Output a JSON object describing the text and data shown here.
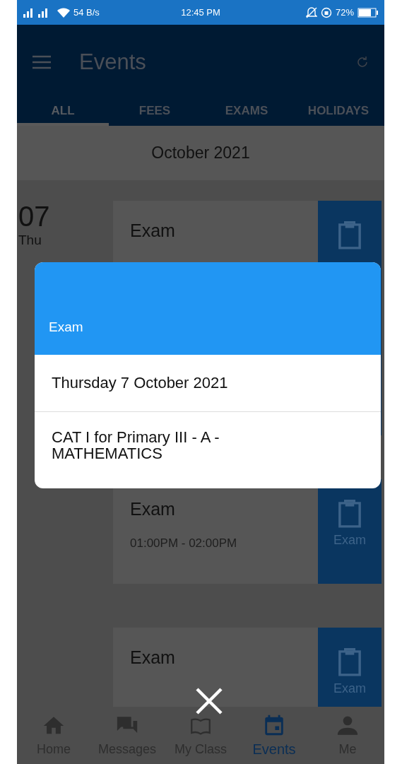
{
  "status_bar": {
    "network": "54 B/s",
    "time": "12:45 PM",
    "battery": "72%"
  },
  "app_bar": {
    "title": "Events"
  },
  "tabs": [
    {
      "label": "ALL",
      "selected": true
    },
    {
      "label": "FEES",
      "selected": false
    },
    {
      "label": "EXAMS",
      "selected": false
    },
    {
      "label": "HOLIDAYS",
      "selected": false
    }
  ],
  "month": "October 2021",
  "events": [
    {
      "day": "07",
      "weekday": "Thu",
      "title": "Exam"
    },
    {
      "title": "Exam",
      "time": "01:00PM - 02:00PM",
      "tag": "Exam"
    },
    {
      "title": "Exam",
      "tag": "Exam"
    }
  ],
  "dialog": {
    "title": "Exam",
    "date": "Thursday 7 October 2021",
    "description": "CAT I for Primary III - A - MATHEMATICS"
  },
  "bottom_nav": [
    {
      "label": "Home",
      "selected": false
    },
    {
      "label": "Messages",
      "selected": false
    },
    {
      "label": "My Class",
      "selected": false
    },
    {
      "label": "Events",
      "selected": true
    },
    {
      "label": "Me",
      "selected": false
    }
  ]
}
